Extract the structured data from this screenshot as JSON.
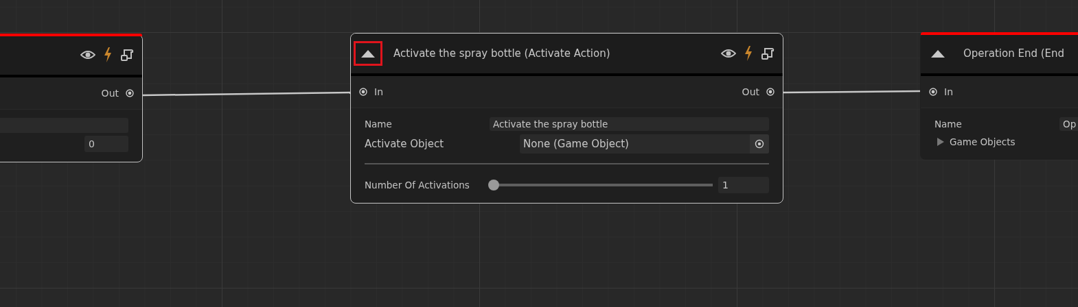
{
  "nodes": [
    {
      "selected": true,
      "alert_bar": true,
      "header_icons": true,
      "outputs": [
        {
          "label": "Out"
        }
      ],
      "fields": [
        {
          "kind": "text"
        },
        {
          "kind": "number",
          "value": "0"
        }
      ]
    },
    {
      "title": "Activate the spray bottle (Activate Action)",
      "selected": true,
      "alert_bar": false,
      "header_icons": true,
      "collapse_highlighted": true,
      "inputs": [
        {
          "label": "In"
        }
      ],
      "outputs": [
        {
          "label": "Out"
        }
      ],
      "fields": [
        {
          "kind": "text",
          "label": "Name",
          "value": "Activate the spray bottle"
        },
        {
          "kind": "object",
          "label": "Activate Object",
          "value": "None (Game Object)"
        },
        {
          "kind": "slider",
          "label": "Number Of Activations",
          "level": 0,
          "value": "1"
        }
      ]
    },
    {
      "title": "Operation End (End",
      "selected": false,
      "alert_bar": true,
      "collapse_highlighted": false,
      "inputs": [
        {
          "label": "In"
        }
      ],
      "fields": [
        {
          "kind": "text",
          "label": "Name",
          "value": "Op"
        },
        {
          "kind": "foldout",
          "label": "Game Objects",
          "expanded": false
        }
      ]
    }
  ]
}
